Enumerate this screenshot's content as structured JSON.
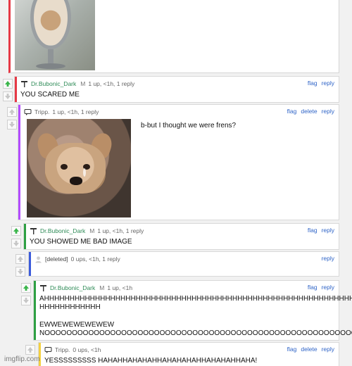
{
  "colors": {
    "red": "#e63946",
    "purple": "#b34cff",
    "green": "#2ea043",
    "blue": "#3b5bdb",
    "yellow": "#f4d03f"
  },
  "icons": {
    "upvote": "up-arrow-icon",
    "downvote": "down-arrow-icon",
    "user_badge": "user-badge-icon",
    "speech": "speech-bubble-icon",
    "deleted": "deleted-user-icon"
  },
  "thread": {
    "comments": [
      {
        "user": "Dr.Bubonic_Dark",
        "mark": "M",
        "stats": "1 up, <1h, 1 reply",
        "text": "YOU SCARED ME",
        "actions": [
          "flag",
          "reply"
        ]
      },
      {
        "user": "Tripp.",
        "stats": "1 up, <1h, 1 reply",
        "text": "b-but I thought we were frens?",
        "actions": [
          "flag",
          "delete",
          "reply"
        ]
      },
      {
        "user": "Dr.Bubonic_Dark",
        "mark": "M",
        "stats": "1 up, <1h, 1 reply",
        "text": "YOU SHOWED ME BAD IMAGE",
        "actions": [
          "flag",
          "reply"
        ]
      },
      {
        "user": "[deleted]",
        "stats": "0 ups, <1h, 1 reply",
        "text": "",
        "actions": [
          "reply"
        ]
      },
      {
        "user": "Dr.Bubonic_Dark",
        "mark": "M",
        "stats": "1 up, <1h",
        "text_lines": [
          "AHHHHHHHHHHHHHHHHHHHHHHHHHHHHHHHHHHHHHHHHHHHHHHHHHHHHHHHHHHHHH",
          "HHHHHHHHHHHH",
          "",
          "EWWEWEWEWEWEW",
          "NOOOOOOOOOOOOOOOOOOOOOOOOOOOOOOOOOOOOOOOOOOOOOOOOOOOOOOOOOO"
        ],
        "actions": [
          "flag",
          "reply"
        ]
      },
      {
        "user": "Tripp.",
        "stats": "0 ups, <1h",
        "text": "YESSSSSSSSS HAHAHHAHAHAHHAHAHAHAHHAHAHAHHAHA!",
        "actions": [
          "flag",
          "delete",
          "reply"
        ]
      }
    ]
  },
  "watermark": "imgflip.com"
}
